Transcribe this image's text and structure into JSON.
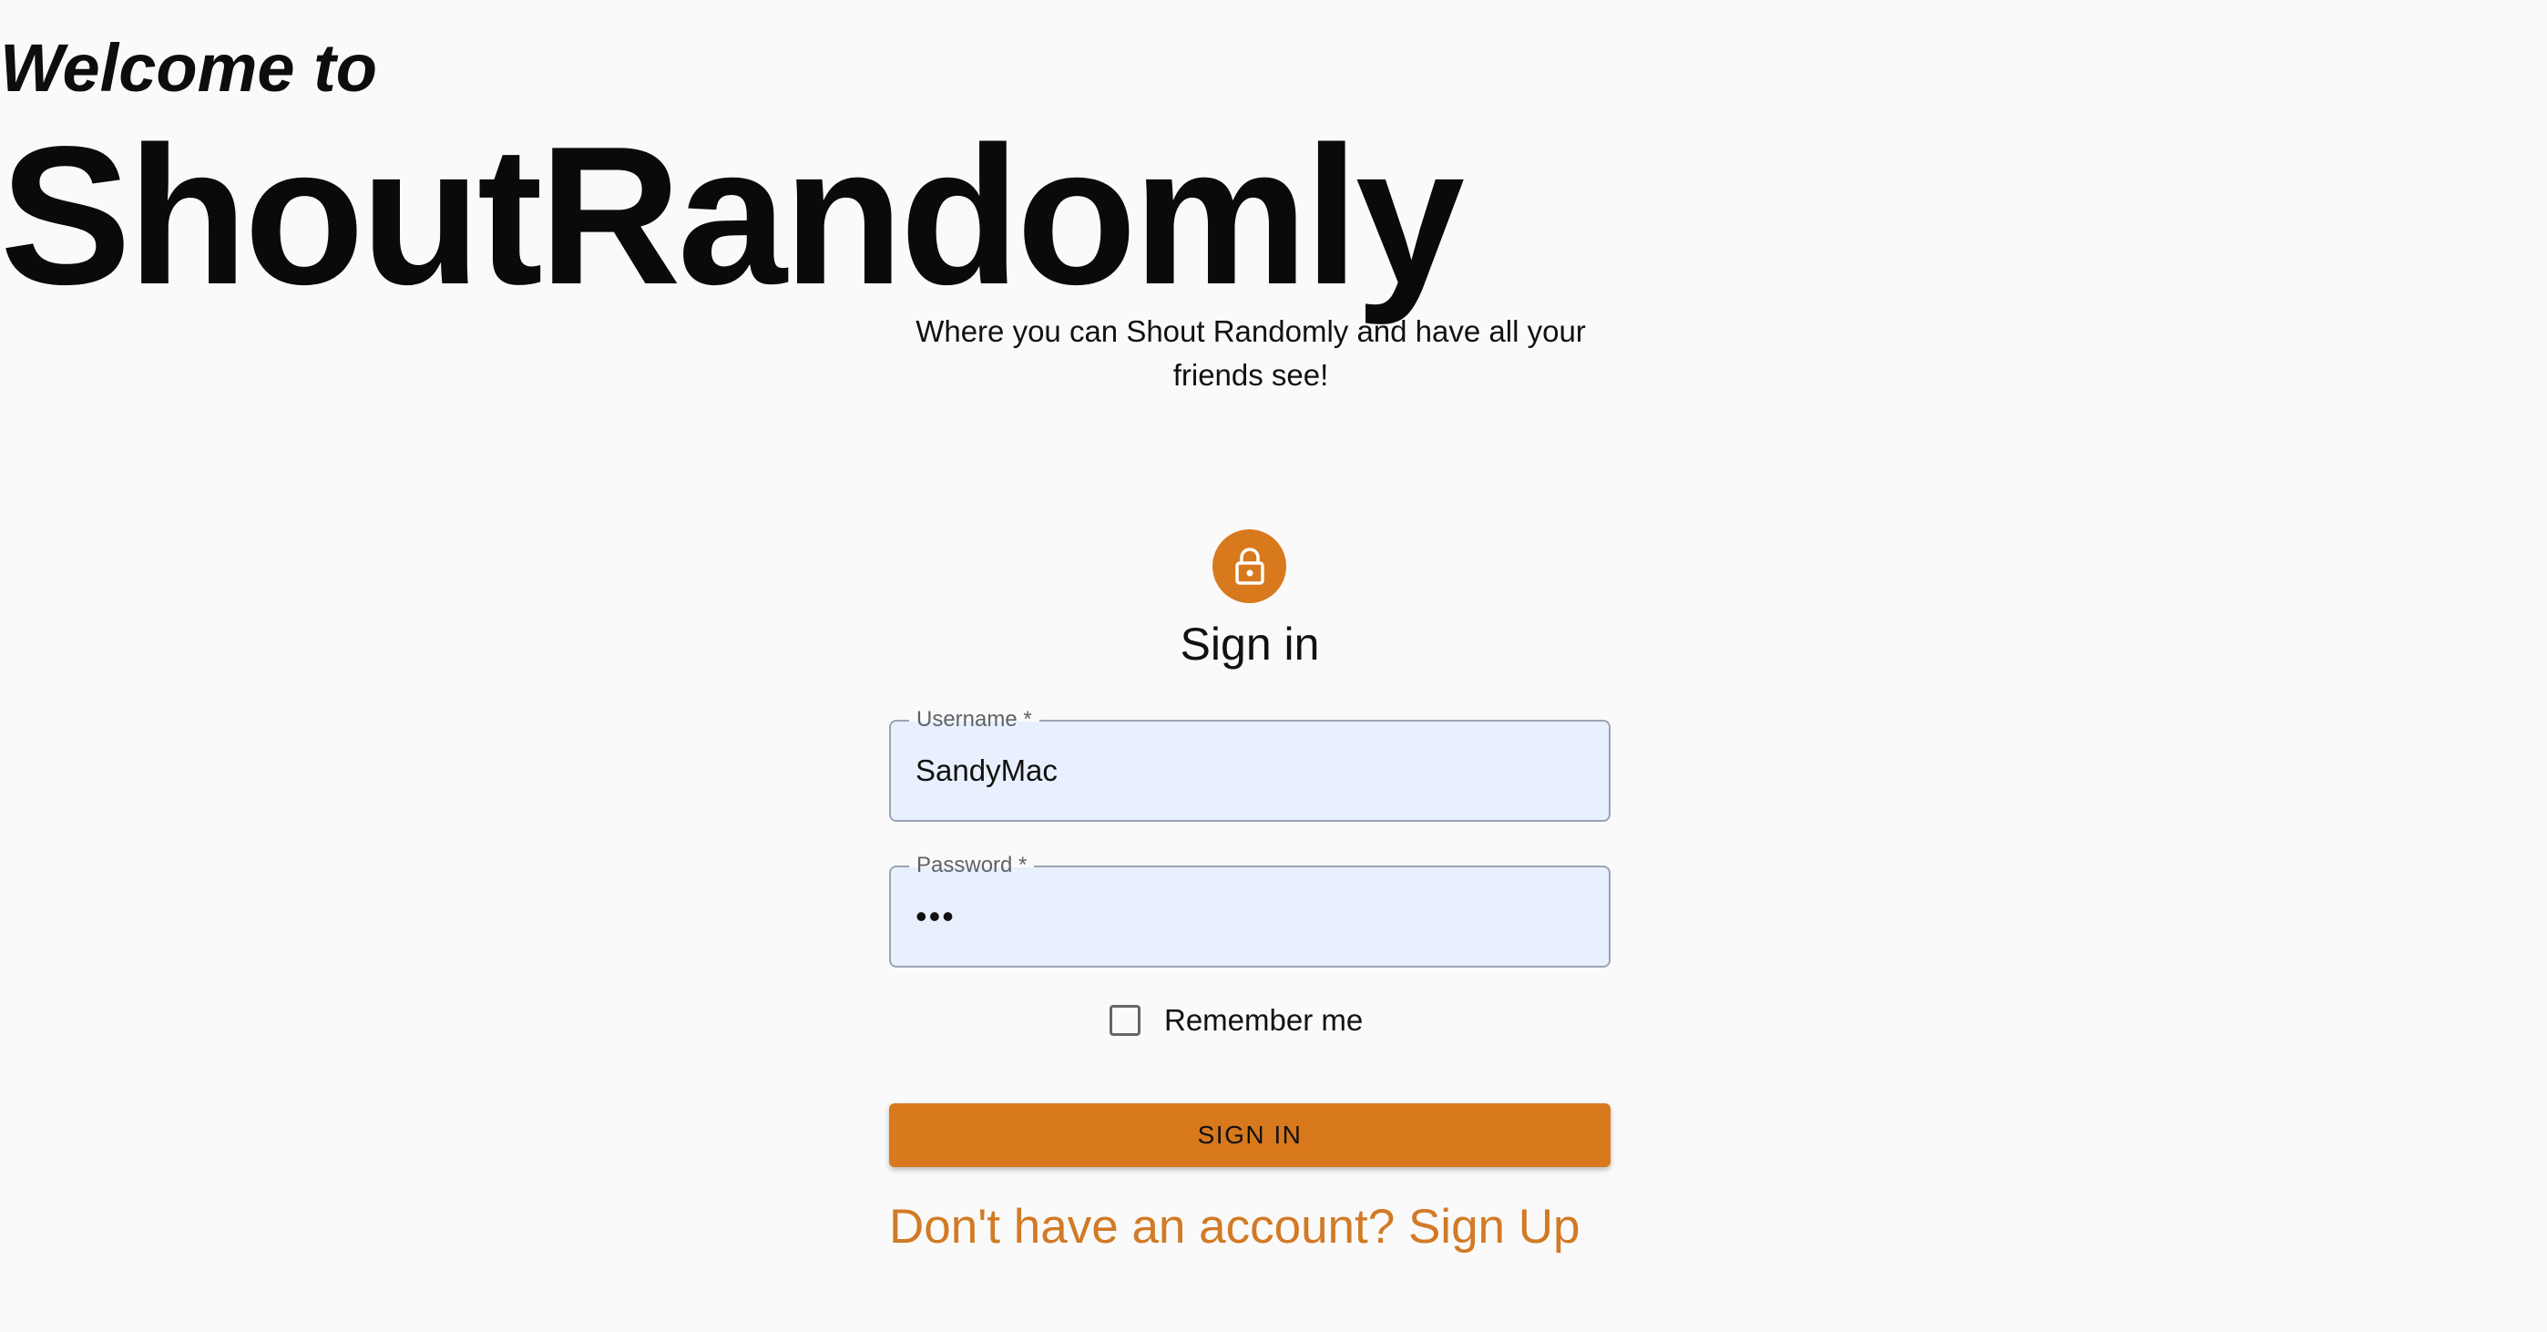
{
  "hero": {
    "welcome": "Welcome to",
    "brand": "ShoutRandomly",
    "tagline": "Where you can Shout Randomly and have all your friends see!"
  },
  "form": {
    "icon": "lock-icon",
    "title": "Sign in",
    "username": {
      "label": "Username",
      "required_mark": "*",
      "value": "SandyMac"
    },
    "password": {
      "label": "Password",
      "required_mark": "*",
      "value": "•••"
    },
    "remember_label": "Remember me",
    "remember_checked": false,
    "submit_label": "SIGN IN",
    "signup_link": "Don't have an account? Sign Up"
  },
  "colors": {
    "accent": "#d8791d",
    "input_background": "#e8f0fe",
    "page_background": "#fafafa"
  }
}
